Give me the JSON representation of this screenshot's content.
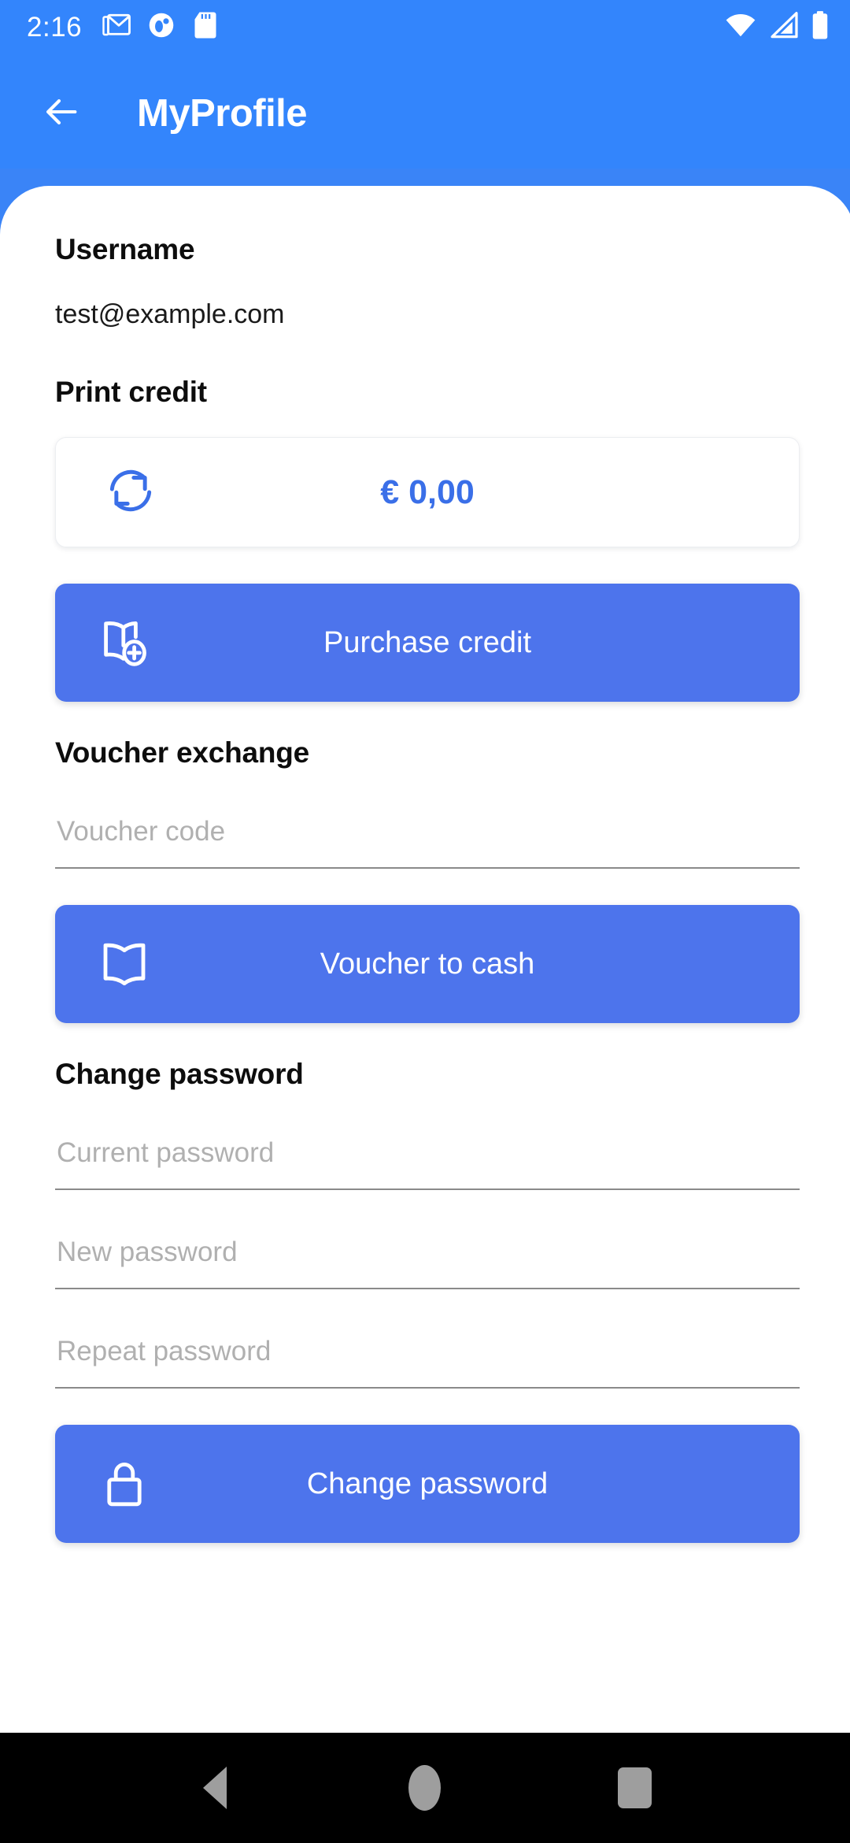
{
  "status_bar": {
    "clock": "2:16",
    "left_icons": [
      "gmail-icon",
      "notification-circle-icon",
      "sd-card-icon"
    ],
    "right_icons": [
      "wifi-icon",
      "cellular-signal-icon",
      "battery-icon"
    ]
  },
  "app_bar": {
    "back_icon": "arrow-left-icon",
    "title": "MyProfile"
  },
  "colors": {
    "header_blue": "#3385fc",
    "button_blue": "#4d74ec",
    "credit_blue": "#3a6fe8",
    "placeholder_grey": "#b0b0b0",
    "underline_grey": "#8a8a8a"
  },
  "username_section": {
    "heading": "Username",
    "value": "test@example.com"
  },
  "print_credit_section": {
    "heading": "Print credit",
    "refresh_icon": "refresh-sync-icon",
    "amount": "€ 0,00",
    "purchase_button": {
      "label": "Purchase credit",
      "icon": "book-plus-icon"
    }
  },
  "voucher_section": {
    "heading": "Voucher exchange",
    "code_input": {
      "placeholder": "Voucher code",
      "value": ""
    },
    "cash_button": {
      "label": "Voucher to cash",
      "icon": "book-open-icon"
    }
  },
  "password_section": {
    "heading": "Change password",
    "current_input": {
      "placeholder": "Current password",
      "value": ""
    },
    "new_input": {
      "placeholder": "New password",
      "value": ""
    },
    "repeat_input": {
      "placeholder": "Repeat password",
      "value": ""
    },
    "submit_button": {
      "label": "Change password",
      "icon": "lock-icon"
    }
  },
  "nav_bar": {
    "back_label": "Back",
    "home_label": "Home",
    "recents_label": "Recents"
  }
}
